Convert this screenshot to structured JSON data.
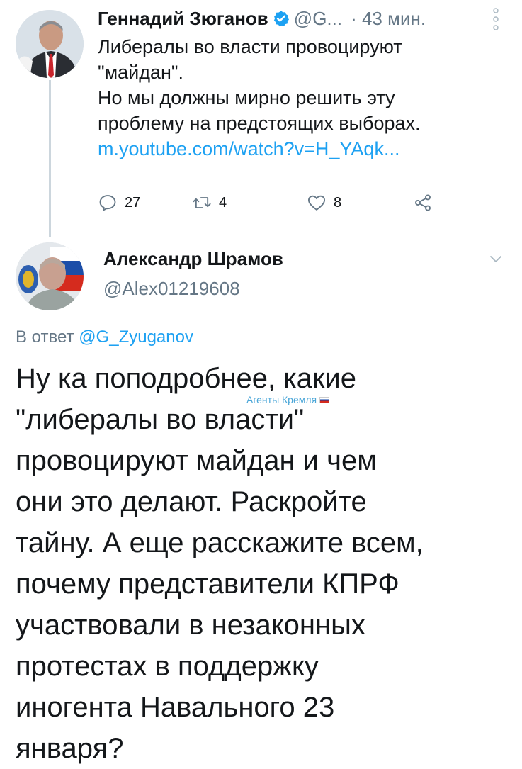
{
  "tweet_1": {
    "author_name": "Геннадий Зюганов",
    "handle": "@G...",
    "time": "· 43 мин.",
    "text_lines": [
      "Либералы во власти провоцируют",
      "\"майдан\".",
      "Но мы должны мирно решить эту",
      "проблему на предстоящих выборах."
    ],
    "link": "m.youtube.com/watch?v=H_YAqk...",
    "reply_count": "27",
    "retweet_count": "4",
    "like_count": "8",
    "icons": {
      "verified": "verified-badge-icon",
      "more": "more-vertical-icon",
      "reply": "reply-icon",
      "retweet": "retweet-icon",
      "like": "heart-icon",
      "share": "share-icon"
    }
  },
  "tweet_2": {
    "author_name": "Александр Шрамов",
    "handle": "@Alex01219608",
    "reply_prefix": "В ответ",
    "reply_handle": "@G_Zyuganov",
    "text_lines": [
      "Ну ка поподробнее, какие",
      "\"либералы во власти\"",
      "провоцируют майдан и чем",
      "они это делают. Раскройте",
      "тайну. А еще расскажите всем,",
      "почему представители КПРФ",
      "участвовали в незаконных",
      "протестах в поддержку",
      "иногента Навального 23",
      "января?"
    ],
    "icons": {
      "menu": "chevron-down-icon"
    }
  },
  "watermark": {
    "text": "Агенты Кремля"
  },
  "colors": {
    "link": "#1da1f2",
    "secondary": "#657786",
    "text": "#14171a",
    "thread_line": "#ccd6dd"
  }
}
